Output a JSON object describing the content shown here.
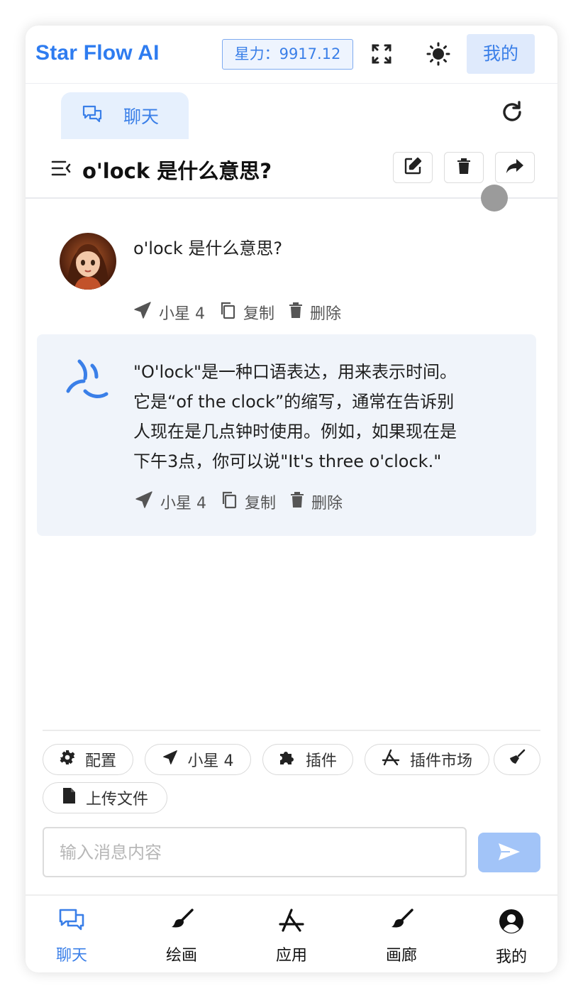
{
  "header": {
    "brand": "Star Flow AI",
    "power_label": "星力：9917.12",
    "mine_button": "我的"
  },
  "tabs": [
    {
      "label": "聊天",
      "icon": "chat-icon",
      "active": true
    }
  ],
  "conversation": {
    "title": "o'lock 是什么意思?"
  },
  "messages": [
    {
      "role": "user",
      "text": "o'lock 是什么意思?",
      "actions": {
        "model": "小星 4",
        "copy": "复制",
        "delete": "删除"
      }
    },
    {
      "role": "assistant",
      "lines": [
        "\"O'lock\"是一种口语表达，用来表示时间。",
        "它是“of the clock”的缩写，通常在告诉别",
        "人现在是几点钟时使用。例如，如果现在是",
        "下午3点，你可以说\"It's three o'clock.\""
      ],
      "actions": {
        "model": "小星 4",
        "copy": "复制",
        "delete": "删除"
      }
    }
  ],
  "composer": {
    "chips": {
      "config": "配置",
      "model": "小星 4",
      "plugins": "插件",
      "plugin_market": "插件市场",
      "upload": "上传文件"
    },
    "input_placeholder": "输入消息内容"
  },
  "bottom_nav": [
    {
      "label": "聊天",
      "icon": "chat-icon",
      "active": true
    },
    {
      "label": "绘画",
      "icon": "brush-icon"
    },
    {
      "label": "应用",
      "icon": "app-store-icon"
    },
    {
      "label": "画廊",
      "icon": "brush-icon"
    },
    {
      "label": "我的",
      "icon": "user-circle-icon"
    }
  ],
  "colors": {
    "accent": "#3a7fe8",
    "ai_bubble": "#f0f4fa",
    "send_button": "#a2c4f8"
  }
}
